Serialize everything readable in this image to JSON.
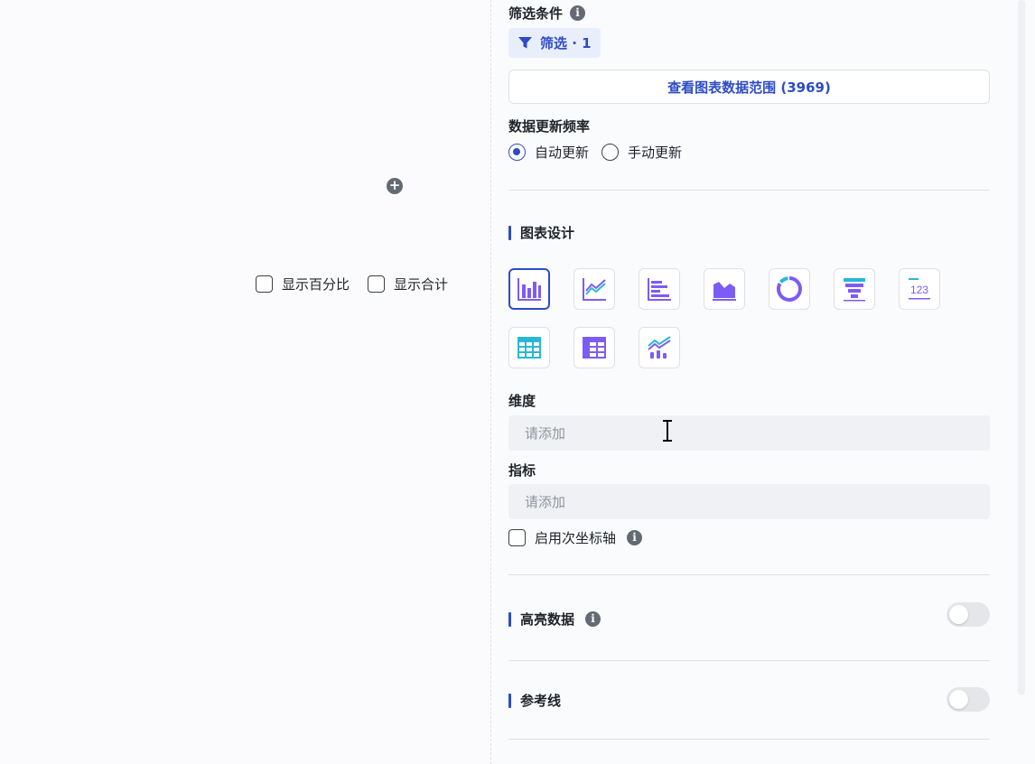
{
  "canvas": {
    "add_icon": "plus-circle-icon",
    "show_percent_label": "显示百分比",
    "show_total_label": "显示合计"
  },
  "filter": {
    "title": "筛选条件",
    "tag_label": "筛选 · 1",
    "view_range_button": "查看图表数据范围 (3969)"
  },
  "update_frequency": {
    "title": "数据更新频率",
    "options": [
      "自动更新",
      "手动更新"
    ],
    "selected": "自动更新"
  },
  "chart_design": {
    "title": "图表设计",
    "chart_types": [
      "column",
      "line",
      "bar",
      "area",
      "donut",
      "funnel",
      "metric",
      "table",
      "pivot-table",
      "combo"
    ],
    "selected_type": "column"
  },
  "dimension": {
    "title": "维度",
    "placeholder": "请添加"
  },
  "metric": {
    "title": "指标",
    "placeholder": "请添加"
  },
  "secondary_axis": {
    "label": "启用次坐标轴"
  },
  "highlight": {
    "title": "高亮数据",
    "enabled": false
  },
  "reference_line": {
    "title": "参考线",
    "enabled": false
  },
  "colors": {
    "accent": "#2e4cc6",
    "border": "#dee0e3",
    "chart_teal": "#29b7d6",
    "chart_purple": "#7c5cf5"
  }
}
